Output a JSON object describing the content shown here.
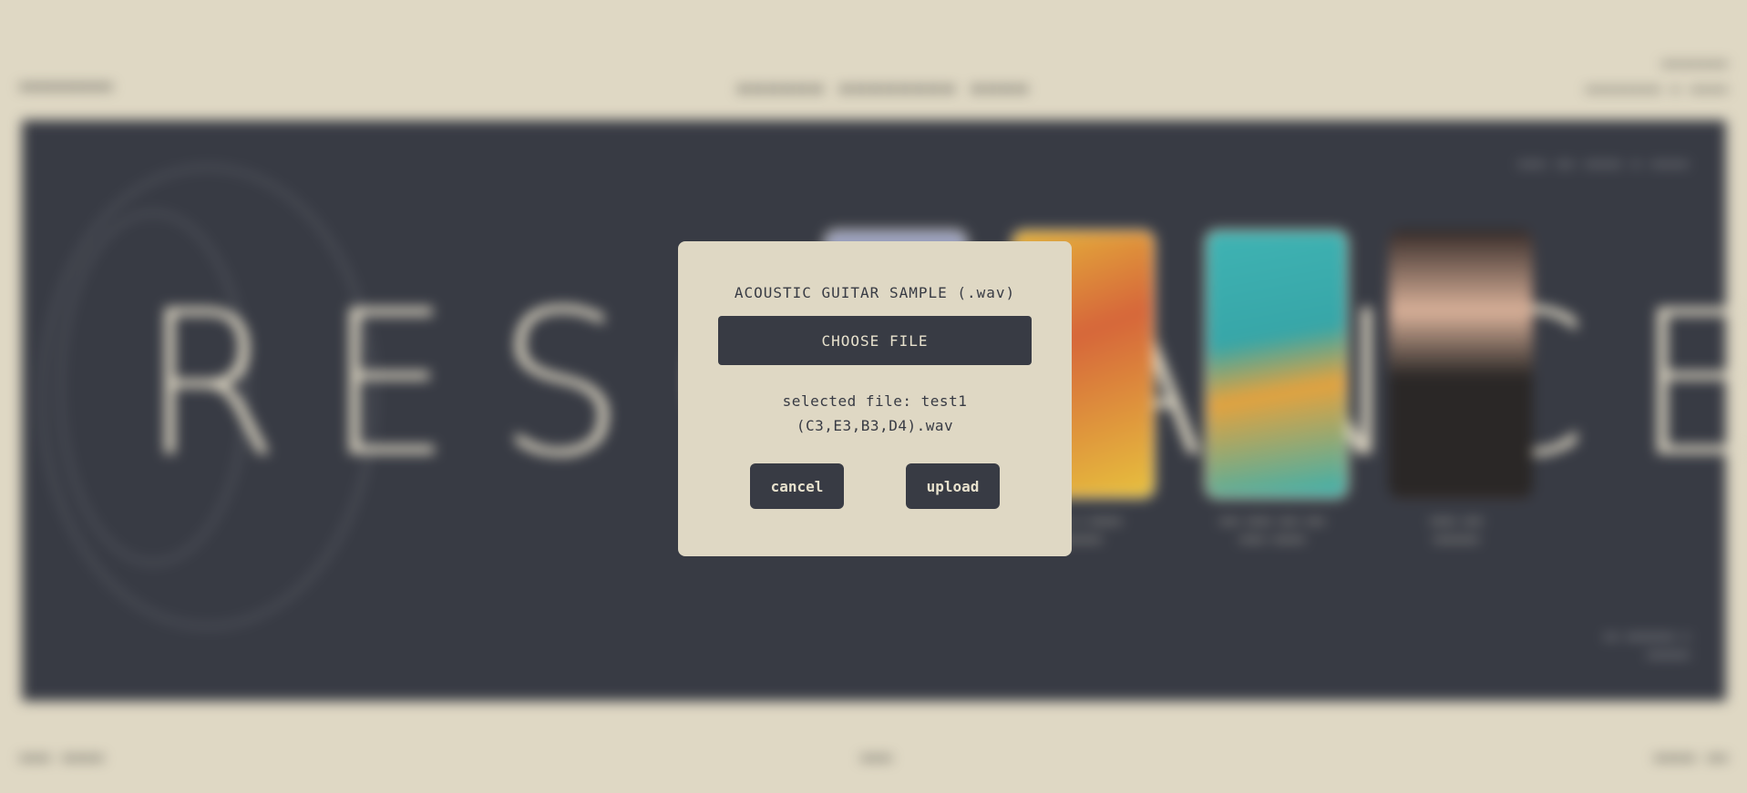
{
  "modal": {
    "title": "ACOUSTIC GUITAR SAMPLE (.wav)",
    "choose_label": "CHOOSE FILE",
    "selected_line1": "selected file: test1",
    "selected_line2": "(C3,E3,B3,D4).wav",
    "cancel_label": "cancel",
    "upload_label": "upload"
  },
  "background": {
    "big_word": "RESONANCE",
    "colors": {
      "page_bg": "#dfd8c4",
      "panel_bg": "#383b44",
      "modal_bg": "#dfd8c4",
      "button_bg": "#383b44",
      "button_text": "#e7e1cd"
    }
  }
}
